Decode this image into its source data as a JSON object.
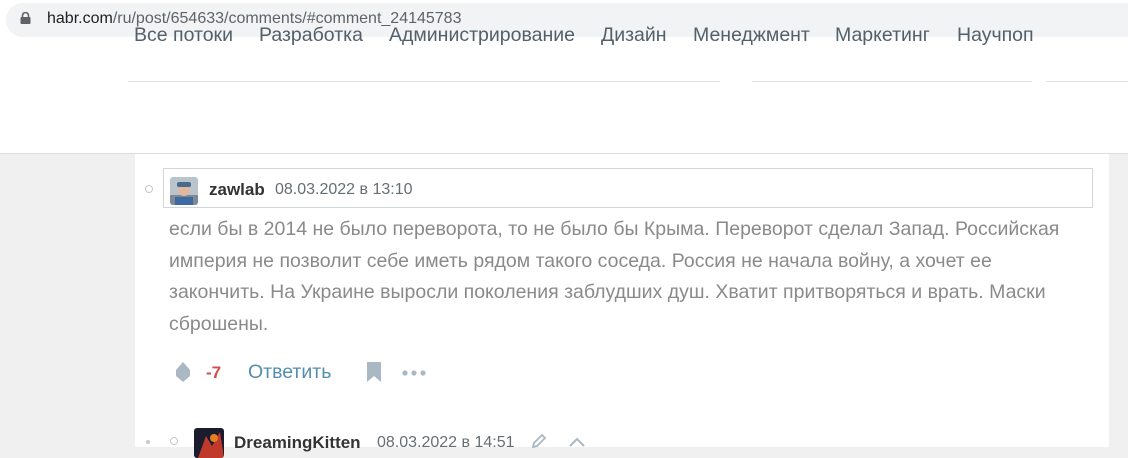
{
  "browser": {
    "url_host": "habr.com",
    "url_path": "/ru/post/654633/comments/#comment_24145783",
    "lock_icon": "lock-icon"
  },
  "nav": {
    "flows": [
      {
        "label": "Все потоки"
      },
      {
        "label": "Разработка"
      },
      {
        "label": "Администрирование"
      },
      {
        "label": "Дизайн"
      },
      {
        "label": "Менеджмент"
      },
      {
        "label": "Маркетинг"
      },
      {
        "label": "Научпоп"
      }
    ]
  },
  "comment": {
    "username": "zawlab",
    "datetime": "08.03.2022 в 13:10",
    "text": "если бы в 2014 не было переворота, то не было бы Крыма. Переворот сделал Запад. Российская империя не позволит себе иметь рядом такого соседа. Россия не начала войну, а хочет ее закончить. На Украине выросли поколения заблудших душ. Хватит притворяться и врать. Маски сброшены.",
    "score": "-7",
    "reply_label": "Ответить",
    "score_color": "#d04e4e",
    "link_color": "#548eaa"
  },
  "next_comment": {
    "username": "DreamingKitten",
    "datetime": "08.03.2022 в 14:51"
  }
}
